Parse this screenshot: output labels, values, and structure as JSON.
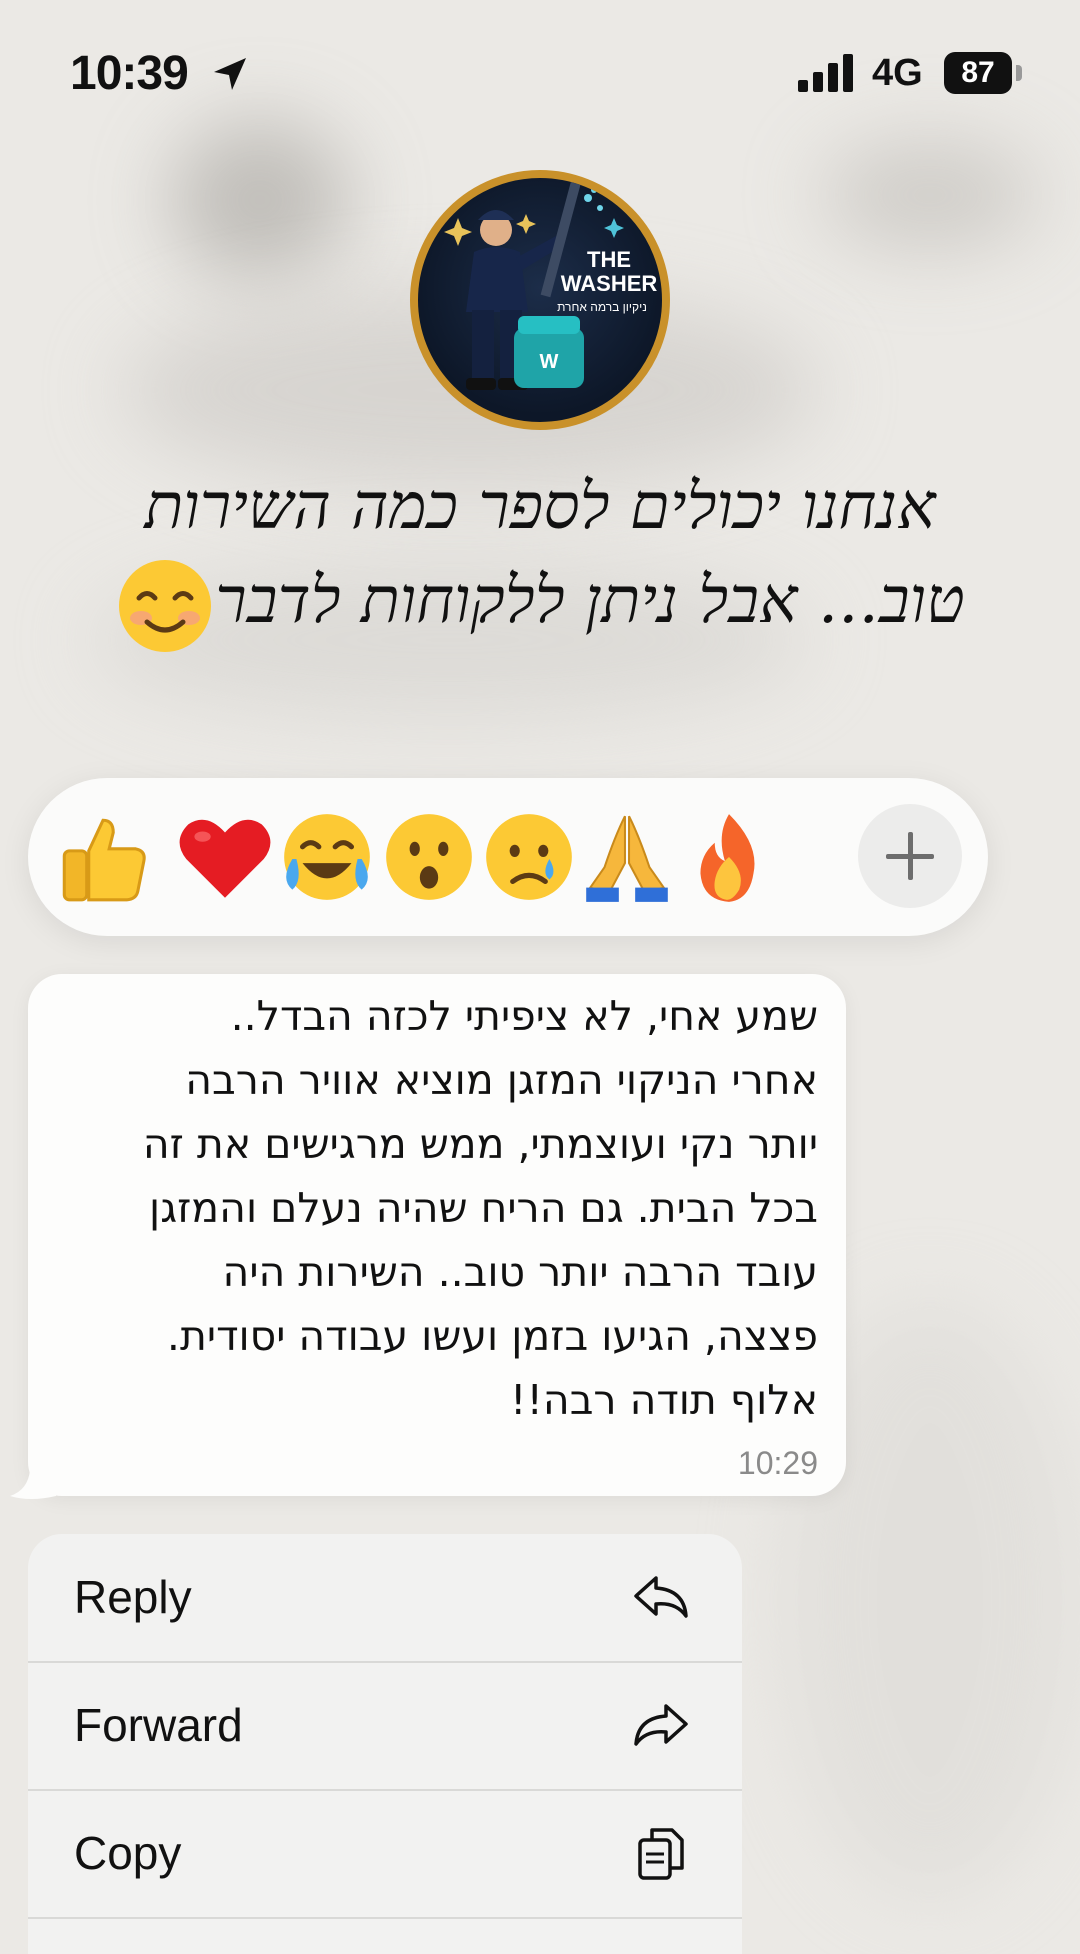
{
  "status_bar": {
    "time": "10:39",
    "network": "4G",
    "battery": "87",
    "icons": [
      "location-arrow-icon",
      "signal-bars-icon",
      "battery-icon"
    ]
  },
  "contact": {
    "avatar_title": "THE WASHER",
    "avatar_subtitle": "ניקיון ברמה אחרת"
  },
  "big_message": {
    "line1": "אנחנו יכולים לספר כמה השירות",
    "line2": "טוב... אבל ניתן ללקוחות לדבר",
    "emoji": "smiling-face-icon"
  },
  "reactions": {
    "items": [
      {
        "name": "thumbs-up",
        "glyph": "👍"
      },
      {
        "name": "red-heart",
        "glyph": "❤️"
      },
      {
        "name": "tears-of-joy",
        "glyph": "😂"
      },
      {
        "name": "surprised",
        "glyph": "😮"
      },
      {
        "name": "sad-tear",
        "glyph": "😢"
      },
      {
        "name": "folded-hands",
        "glyph": "🙏"
      },
      {
        "name": "fire",
        "glyph": "🔥"
      }
    ],
    "more": "plus-icon"
  },
  "message": {
    "lines": [
      "שמע אחי, לא ציפיתי לכזה הבדל..",
      "אחרי הניקוי המזגן מוציא אוויר הרבה",
      "יותר נקי ועוצמתי, ממש מרגישים את זה",
      "בכל הבית. גם הריח שהיה נעלם והמזגן",
      "עובד הרבה יותר טוב.. השירות היה",
      "פצצה, הגיעו בזמן ועשו עבודה יסודית.",
      "אלוף תודה רבה!!"
    ],
    "time": "10:29"
  },
  "menu": {
    "reply": "Reply",
    "forward": "Forward",
    "copy": "Copy"
  },
  "colors": {
    "background": "#ebe9e5",
    "bubble": "#fdfdfc",
    "menu": "#f2f2f1",
    "avatar_ring": "#c9912a"
  }
}
